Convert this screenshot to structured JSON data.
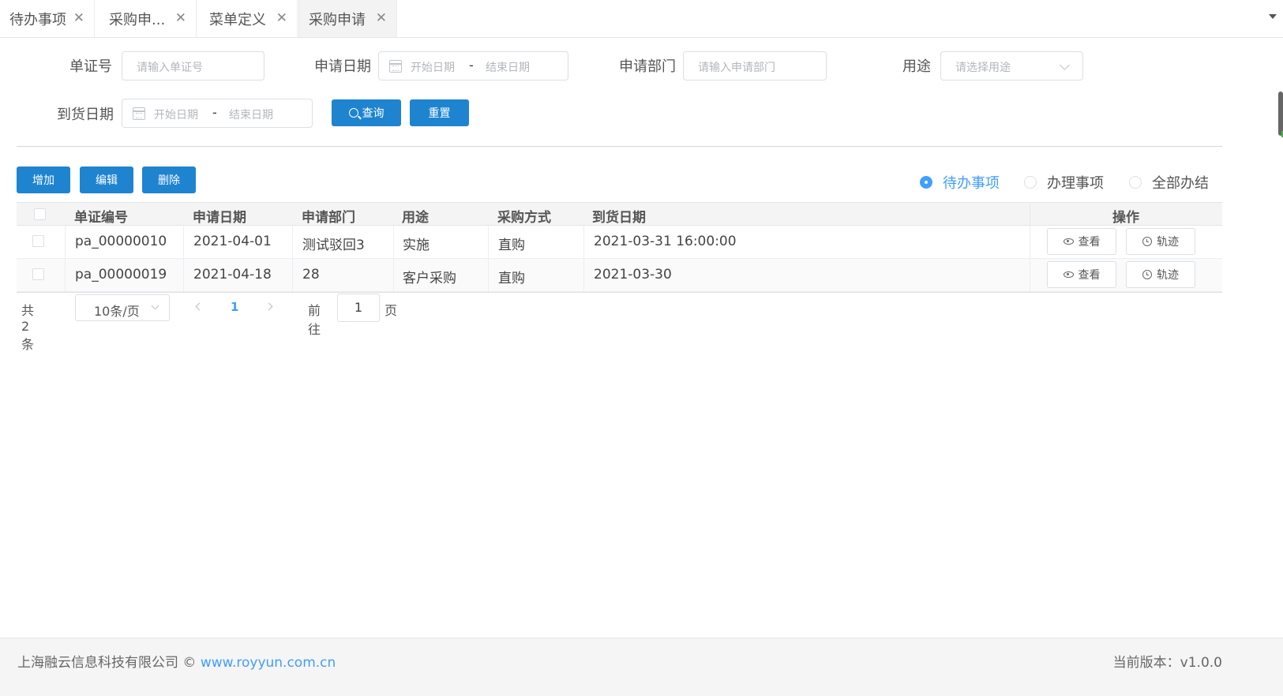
{
  "tabs": [
    {
      "label": "待办事项",
      "close": "✕"
    },
    {
      "label": "采购申...",
      "close": "✕"
    },
    {
      "label": "菜单定义",
      "close": "✕"
    },
    {
      "label": "采购申请",
      "close": "✕"
    }
  ],
  "filters": {
    "doc_no_label": "单证号",
    "doc_no_placeholder": "请输入单证号",
    "apply_date_label": "申请日期",
    "apply_date_start": "开始日期",
    "apply_date_end": "结束日期",
    "range_sep": "-",
    "dept_label": "申请部门",
    "dept_placeholder": "请输入申请部门",
    "usage_label": "用途",
    "usage_placeholder": "请选择用途",
    "arrival_label": "到货日期",
    "arrival_start": "开始日期",
    "arrival_end": "结束日期",
    "search_btn": "查询",
    "reset_btn": "重置"
  },
  "toolbar": {
    "add": "增加",
    "edit": "编辑",
    "delete": "删除"
  },
  "view_filter": {
    "options": [
      "待办事项",
      "办理事项",
      "全部办结"
    ],
    "selected": "待办事项"
  },
  "table": {
    "columns": [
      "单证编号",
      "申请日期",
      "申请部门",
      "用途",
      "采购方式",
      "到货日期",
      "操作"
    ],
    "rows": [
      {
        "doc_no": "pa_00000010",
        "apply_date": "2021-04-01",
        "dept": "测试驳回3",
        "usage": "实施",
        "method": "直购",
        "arrival": "2021-03-31 16:00:00"
      },
      {
        "doc_no": "pa_00000019",
        "apply_date": "2021-04-18",
        "dept": "28",
        "usage": "客户采购",
        "method": "直购",
        "arrival": "2021-03-30"
      }
    ],
    "actions": {
      "view": "查看",
      "trace": "轨迹"
    }
  },
  "pagination": {
    "total": "共 2 条",
    "page_size": "10条/页",
    "current_page": "1",
    "goto_label": "前往",
    "goto_value": "1",
    "page_unit": "页"
  },
  "footer": {
    "company": "上海融云信息科技有限公司 ©",
    "website": "www.royyun.com.cn",
    "version": "当前版本：v1.0.0"
  },
  "colors": {
    "primary_button": "#1f84d0",
    "accent": "#409eff"
  }
}
